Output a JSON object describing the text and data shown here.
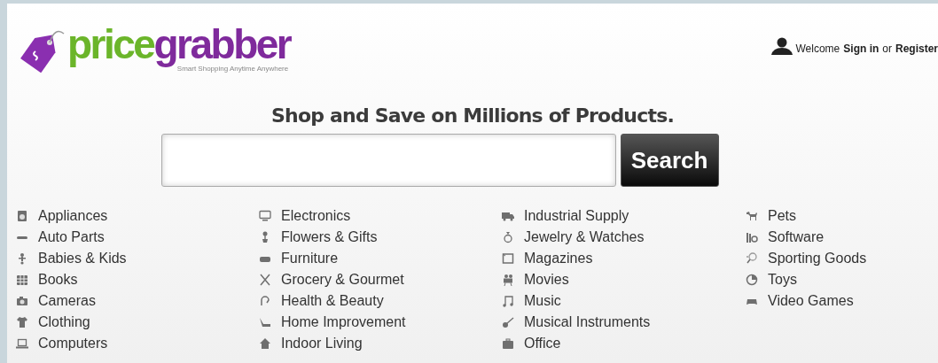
{
  "logo": {
    "name_part_1": "price",
    "name_part_2": "grabber",
    "tagline": "Smart Shopping Anytime Anywhere"
  },
  "account": {
    "welcome": "Welcome",
    "sign_in": "Sign in",
    "or": "or",
    "register": "Register"
  },
  "headline": "Shop and Save on Millions of Products.",
  "search": {
    "button": "Search"
  },
  "categories": [
    [
      "Appliances",
      "Auto Parts",
      "Babies & Kids",
      "Books",
      "Cameras",
      "Clothing",
      "Computers"
    ],
    [
      "Electronics",
      "Flowers & Gifts",
      "Furniture",
      "Grocery & Gourmet",
      "Health & Beauty",
      "Home Improvement",
      "Indoor Living"
    ],
    [
      "Industrial Supply",
      "Jewelry & Watches",
      "Magazines",
      "Movies",
      "Music",
      "Musical Instruments",
      "Office"
    ],
    [
      "Pets",
      "Software",
      "Sporting Goods",
      "Toys",
      "Video Games"
    ]
  ]
}
